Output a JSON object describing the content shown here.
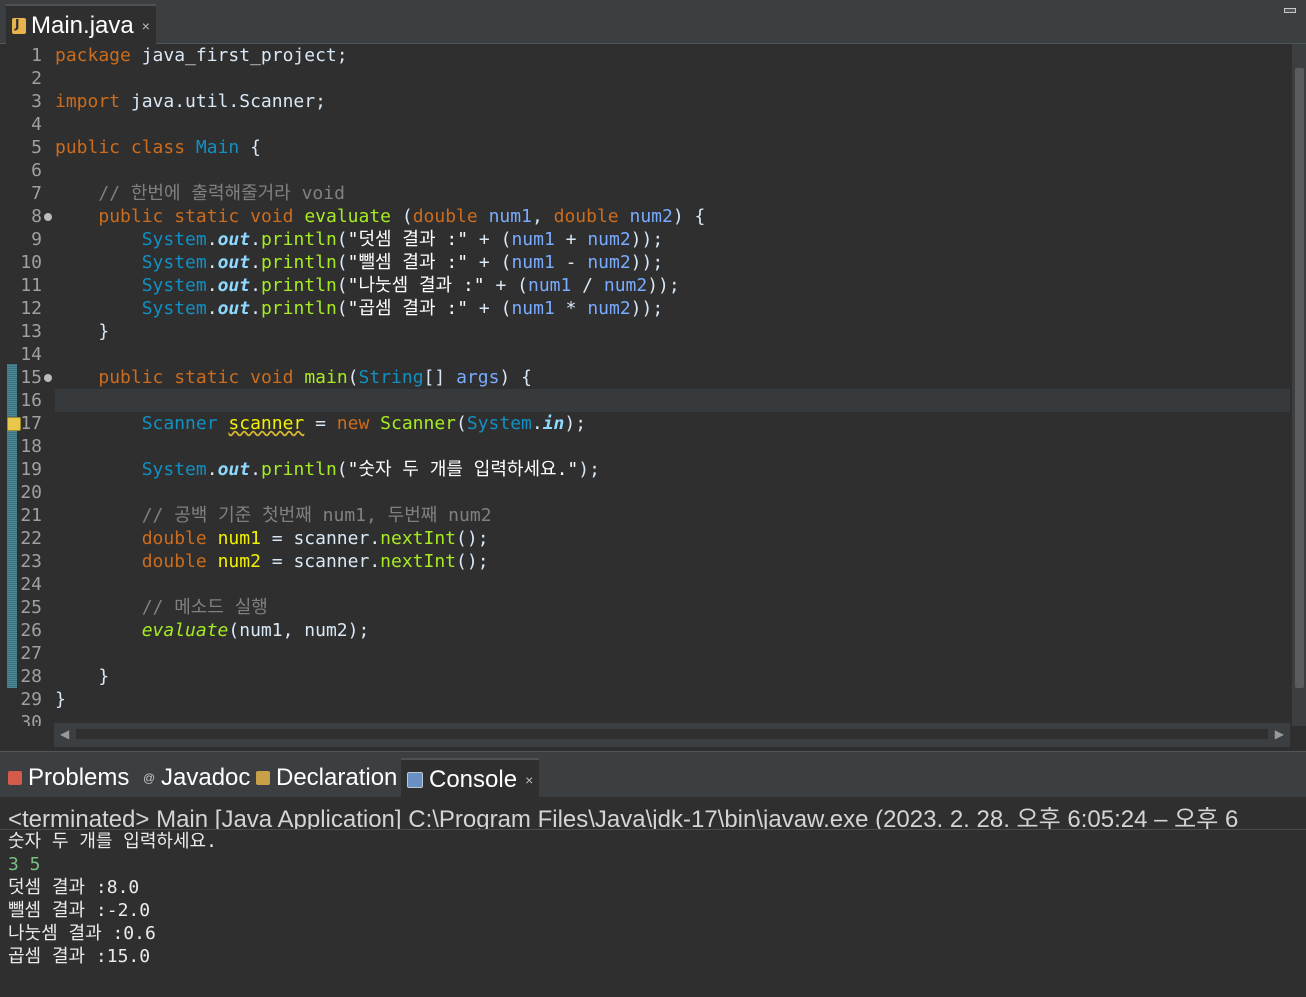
{
  "editor_tab": {
    "label": "Main.java",
    "close": "×"
  },
  "code_lines": [
    {
      "n": "1",
      "tokens": [
        {
          "t": "kw",
          "v": "package"
        },
        {
          "t": "plain",
          "v": " java_first_project;"
        }
      ]
    },
    {
      "n": "2",
      "tokens": []
    },
    {
      "n": "3",
      "tokens": [
        {
          "t": "kw",
          "v": "import"
        },
        {
          "t": "plain",
          "v": " java.util.Scanner;"
        }
      ]
    },
    {
      "n": "4",
      "tokens": []
    },
    {
      "n": "5",
      "tokens": [
        {
          "t": "kw",
          "v": "public"
        },
        {
          "t": "plain",
          "v": " "
        },
        {
          "t": "kw",
          "v": "class"
        },
        {
          "t": "plain",
          "v": " "
        },
        {
          "t": "cls",
          "v": "Main"
        },
        {
          "t": "plain",
          "v": " {"
        }
      ]
    },
    {
      "n": "6",
      "tokens": []
    },
    {
      "n": "7",
      "tokens": [
        {
          "t": "plain",
          "v": "    "
        },
        {
          "t": "cmt",
          "v": "// 한번에 출력해줄거라 void"
        }
      ]
    },
    {
      "n": "8",
      "fold": true,
      "tokens": [
        {
          "t": "plain",
          "v": "    "
        },
        {
          "t": "kw",
          "v": "public"
        },
        {
          "t": "plain",
          "v": " "
        },
        {
          "t": "kw",
          "v": "static"
        },
        {
          "t": "plain",
          "v": " "
        },
        {
          "t": "kw",
          "v": "void"
        },
        {
          "t": "plain",
          "v": " "
        },
        {
          "t": "meth",
          "v": "evaluate"
        },
        {
          "t": "plain",
          "v": " ("
        },
        {
          "t": "kw",
          "v": "double"
        },
        {
          "t": "plain",
          "v": " "
        },
        {
          "t": "param",
          "v": "num1"
        },
        {
          "t": "plain",
          "v": ", "
        },
        {
          "t": "kw",
          "v": "double"
        },
        {
          "t": "plain",
          "v": " "
        },
        {
          "t": "param",
          "v": "num2"
        },
        {
          "t": "plain",
          "v": ") {"
        }
      ]
    },
    {
      "n": "9",
      "tokens": [
        {
          "t": "plain",
          "v": "        "
        },
        {
          "t": "cls",
          "v": "System"
        },
        {
          "t": "plain",
          "v": "."
        },
        {
          "t": "fld",
          "v": "out"
        },
        {
          "t": "plain",
          "v": "."
        },
        {
          "t": "meth",
          "v": "println"
        },
        {
          "t": "plain",
          "v": "("
        },
        {
          "t": "str",
          "v": "\"덧셈 결과 :\""
        },
        {
          "t": "plain",
          "v": " + ("
        },
        {
          "t": "param",
          "v": "num1"
        },
        {
          "t": "plain",
          "v": " + "
        },
        {
          "t": "param",
          "v": "num2"
        },
        {
          "t": "plain",
          "v": "));"
        }
      ]
    },
    {
      "n": "10",
      "tokens": [
        {
          "t": "plain",
          "v": "        "
        },
        {
          "t": "cls",
          "v": "System"
        },
        {
          "t": "plain",
          "v": "."
        },
        {
          "t": "fld",
          "v": "out"
        },
        {
          "t": "plain",
          "v": "."
        },
        {
          "t": "meth",
          "v": "println"
        },
        {
          "t": "plain",
          "v": "("
        },
        {
          "t": "str",
          "v": "\"뺄셈 결과 :\""
        },
        {
          "t": "plain",
          "v": " + ("
        },
        {
          "t": "param",
          "v": "num1"
        },
        {
          "t": "plain",
          "v": " - "
        },
        {
          "t": "param",
          "v": "num2"
        },
        {
          "t": "plain",
          "v": "));"
        }
      ]
    },
    {
      "n": "11",
      "tokens": [
        {
          "t": "plain",
          "v": "        "
        },
        {
          "t": "cls",
          "v": "System"
        },
        {
          "t": "plain",
          "v": "."
        },
        {
          "t": "fld",
          "v": "out"
        },
        {
          "t": "plain",
          "v": "."
        },
        {
          "t": "meth",
          "v": "println"
        },
        {
          "t": "plain",
          "v": "("
        },
        {
          "t": "str",
          "v": "\"나눗셈 결과 :\""
        },
        {
          "t": "plain",
          "v": " + ("
        },
        {
          "t": "param",
          "v": "num1"
        },
        {
          "t": "plain",
          "v": " / "
        },
        {
          "t": "param",
          "v": "num2"
        },
        {
          "t": "plain",
          "v": "));"
        }
      ]
    },
    {
      "n": "12",
      "tokens": [
        {
          "t": "plain",
          "v": "        "
        },
        {
          "t": "cls",
          "v": "System"
        },
        {
          "t": "plain",
          "v": "."
        },
        {
          "t": "fld",
          "v": "out"
        },
        {
          "t": "plain",
          "v": "."
        },
        {
          "t": "meth",
          "v": "println"
        },
        {
          "t": "plain",
          "v": "("
        },
        {
          "t": "str",
          "v": "\"곱셈 결과 :\""
        },
        {
          "t": "plain",
          "v": " + ("
        },
        {
          "t": "param",
          "v": "num1"
        },
        {
          "t": "plain",
          "v": " * "
        },
        {
          "t": "param",
          "v": "num2"
        },
        {
          "t": "plain",
          "v": "));"
        }
      ]
    },
    {
      "n": "13",
      "tokens": [
        {
          "t": "plain",
          "v": "    }"
        }
      ]
    },
    {
      "n": "14",
      "tokens": []
    },
    {
      "n": "15",
      "fold": true,
      "tokens": [
        {
          "t": "plain",
          "v": "    "
        },
        {
          "t": "kw",
          "v": "public"
        },
        {
          "t": "plain",
          "v": " "
        },
        {
          "t": "kw",
          "v": "static"
        },
        {
          "t": "plain",
          "v": " "
        },
        {
          "t": "kw",
          "v": "void"
        },
        {
          "t": "plain",
          "v": " "
        },
        {
          "t": "meth",
          "v": "main"
        },
        {
          "t": "plain",
          "v": "("
        },
        {
          "t": "cls",
          "v": "String"
        },
        {
          "t": "plain",
          "v": "[] "
        },
        {
          "t": "param",
          "v": "args"
        },
        {
          "t": "plain",
          "v": ") {"
        }
      ]
    },
    {
      "n": "16",
      "current": true,
      "tokens": []
    },
    {
      "n": "17",
      "warning": true,
      "tokens": [
        {
          "t": "plain",
          "v": "        "
        },
        {
          "t": "cls",
          "v": "Scanner"
        },
        {
          "t": "plain",
          "v": " "
        },
        {
          "t": "loc-warn",
          "v": "scanner"
        },
        {
          "t": "plain",
          "v": " = "
        },
        {
          "t": "kw",
          "v": "new"
        },
        {
          "t": "plain",
          "v": " "
        },
        {
          "t": "meth",
          "v": "Scanner"
        },
        {
          "t": "plain",
          "v": "("
        },
        {
          "t": "cls",
          "v": "System"
        },
        {
          "t": "plain",
          "v": "."
        },
        {
          "t": "fld",
          "v": "in"
        },
        {
          "t": "plain",
          "v": ");"
        }
      ]
    },
    {
      "n": "18",
      "tokens": []
    },
    {
      "n": "19",
      "tokens": [
        {
          "t": "plain",
          "v": "        "
        },
        {
          "t": "cls",
          "v": "System"
        },
        {
          "t": "plain",
          "v": "."
        },
        {
          "t": "fld",
          "v": "out"
        },
        {
          "t": "plain",
          "v": "."
        },
        {
          "t": "meth",
          "v": "println"
        },
        {
          "t": "plain",
          "v": "("
        },
        {
          "t": "str",
          "v": "\"숫자 두 개를 입력하세요.\""
        },
        {
          "t": "plain",
          "v": ");"
        }
      ]
    },
    {
      "n": "20",
      "tokens": []
    },
    {
      "n": "21",
      "tokens": [
        {
          "t": "plain",
          "v": "        "
        },
        {
          "t": "cmt",
          "v": "// 공백 기준 첫번째 num1, 두번째 num2"
        }
      ]
    },
    {
      "n": "22",
      "tokens": [
        {
          "t": "plain",
          "v": "        "
        },
        {
          "t": "kw",
          "v": "double"
        },
        {
          "t": "plain",
          "v": " "
        },
        {
          "t": "loc",
          "v": "num1"
        },
        {
          "t": "plain",
          "v": " = "
        },
        {
          "t": "plain",
          "v": "scanner"
        },
        {
          "t": "plain",
          "v": "."
        },
        {
          "t": "meth",
          "v": "nextInt"
        },
        {
          "t": "plain",
          "v": "();"
        }
      ]
    },
    {
      "n": "23",
      "tokens": [
        {
          "t": "plain",
          "v": "        "
        },
        {
          "t": "kw",
          "v": "double"
        },
        {
          "t": "plain",
          "v": " "
        },
        {
          "t": "loc",
          "v": "num2"
        },
        {
          "t": "plain",
          "v": " = "
        },
        {
          "t": "plain",
          "v": "scanner"
        },
        {
          "t": "plain",
          "v": "."
        },
        {
          "t": "meth",
          "v": "nextInt"
        },
        {
          "t": "plain",
          "v": "();"
        }
      ]
    },
    {
      "n": "24",
      "tokens": []
    },
    {
      "n": "25",
      "tokens": [
        {
          "t": "plain",
          "v": "        "
        },
        {
          "t": "cmt",
          "v": "// 메소드 실행"
        }
      ]
    },
    {
      "n": "26",
      "tokens": [
        {
          "t": "plain",
          "v": "        "
        },
        {
          "t": "call-italic",
          "v": "evaluate"
        },
        {
          "t": "plain",
          "v": "(num1, num2);"
        }
      ]
    },
    {
      "n": "27",
      "tokens": []
    },
    {
      "n": "28",
      "tokens": [
        {
          "t": "plain",
          "v": "    }"
        }
      ]
    },
    {
      "n": "29",
      "tokens": [
        {
          "t": "plain",
          "v": "}"
        }
      ]
    },
    {
      "n": "30",
      "tokens": []
    }
  ],
  "views": {
    "tabs": [
      {
        "label": "Problems",
        "icon": "problems-icon"
      },
      {
        "label": "Javadoc",
        "icon": "javadoc-icon"
      },
      {
        "label": "Declaration",
        "icon": "declaration-icon"
      },
      {
        "label": "Console",
        "icon": "console-icon",
        "active": true
      }
    ],
    "console_close": "×"
  },
  "console": {
    "status": "<terminated> Main [Java Application] C:\\Program Files\\Java\\jdk-17\\bin\\javaw.exe  (2023. 2. 28. 오후 6:05:24 – 오후 6",
    "lines": [
      {
        "text": "숫자 두 개를 입력하세요.",
        "kind": "out"
      },
      {
        "text": "3 5",
        "kind": "in"
      },
      {
        "text": "덧셈 결과 :8.0",
        "kind": "out"
      },
      {
        "text": "뺄셈 결과 :-2.0",
        "kind": "out"
      },
      {
        "text": "나눗셈 결과 :0.6",
        "kind": "out"
      },
      {
        "text": "곱셈 결과 :15.0",
        "kind": "out"
      }
    ]
  },
  "colors": {
    "keyword": "#cc6c1d",
    "class": "#1290c3",
    "method": "#a7ec21",
    "field": "#8dd9ff",
    "parameter": "#79abff",
    "local": "#f2f200",
    "comment": "#808080",
    "user_input": "#79c080"
  }
}
